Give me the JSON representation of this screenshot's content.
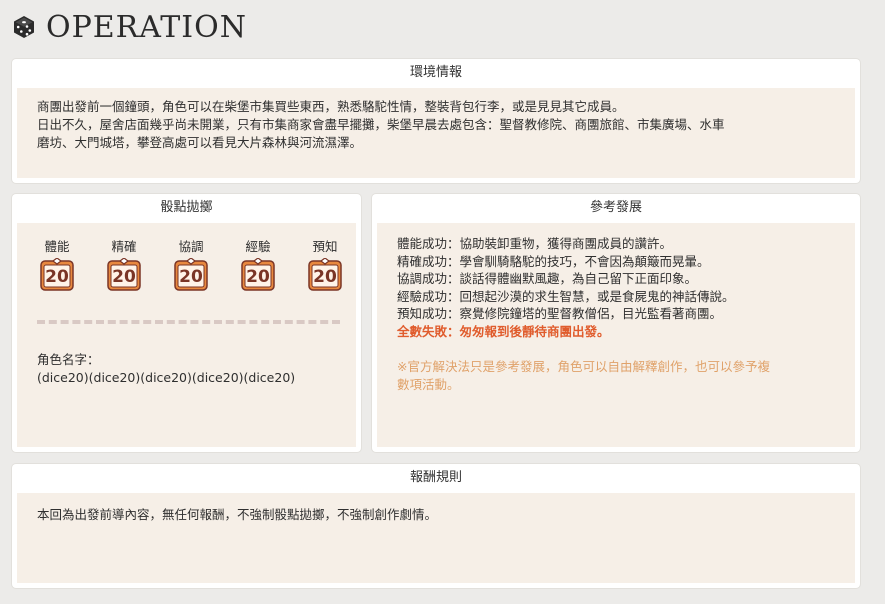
{
  "header": {
    "title": "OPERATION",
    "icon": "dice-icon"
  },
  "environment": {
    "title": "環境情報",
    "lines": [
      "商團出發前一個鐘頭，角色可以在柴堡市集買些東西，熟悉駱駝性情，整裝背包行李，或是見見其它成員。",
      "日出不久，屋舍店面幾乎尚未開業，只有市集商家會盡早擺攤，柴堡早晨去處包含：聖督教修院、商團旅館、市集廣場、水車",
      "磨坊、大門城塔，攀登高處可以看見大片森林與河流濕澤。"
    ]
  },
  "dice_roll": {
    "title": "骰點拋擲",
    "dice": [
      {
        "label": "體能",
        "value": "20"
      },
      {
        "label": "精確",
        "value": "20"
      },
      {
        "label": "協調",
        "value": "20"
      },
      {
        "label": "經驗",
        "value": "20"
      },
      {
        "label": "預知",
        "value": "20"
      }
    ],
    "character_label": "角色名字：",
    "formula": "(dice20)(dice20)(dice20)(dice20)(dice20)",
    "die_color": "#e8883f",
    "die_number_color": "#7a3526"
  },
  "reference": {
    "title": "參考發展",
    "lines": [
      "體能成功：協助裝卸重物，獲得商團成員的讚許。",
      "精確成功：學會馴騎駱駝的技巧，不會因為顛簸而晃暈。",
      "協調成功：談話得體幽默風趣，為自己留下正面印象。",
      "經驗成功：回想起沙漠的求生智慧，或是食屍鬼的神話傳說。",
      "預知成功：察覺修院鐘塔的聖督教僧侶，目光監看著商團。"
    ],
    "fail_line": "全數失敗：匆匆報到後靜待商團出發。",
    "note_lines": [
      "※官方解決法只是參考發展，角色可以自由解釋創作，也可以參予複",
      "數項活動。"
    ],
    "fail_color": "#e05c2d",
    "note_color": "#e0a26a"
  },
  "reward": {
    "title": "報酬規則",
    "text": "本回為出發前導內容，無任何報酬，不強制骰點拋擲，不強制創作劇情。"
  }
}
